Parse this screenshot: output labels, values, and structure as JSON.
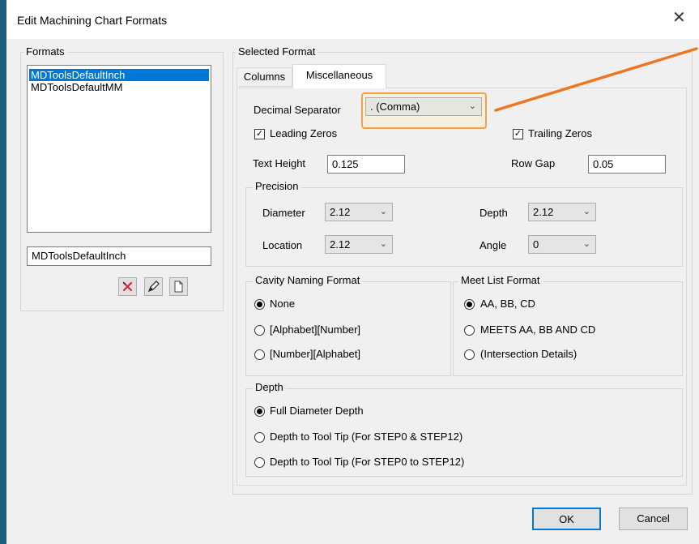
{
  "window": {
    "title": "Edit Machining Chart Formats",
    "close_glyph": "✕"
  },
  "formats": {
    "group_label": "Formats",
    "items": [
      "MDToolsDefaultInch",
      "MDToolsDefaultMM"
    ],
    "selected_index": 0,
    "name_value": "MDToolsDefaultInch",
    "icons": [
      "delete-icon",
      "edit-pencil-icon",
      "new-document-icon"
    ]
  },
  "selected_format": {
    "group_label": "Selected Format",
    "tabs": [
      "Columns",
      "Miscellaneous"
    ],
    "active_tab": "Miscellaneous"
  },
  "misc": {
    "decimal_separator_label": "Decimal Separator",
    "decimal_separator_value": ". (Comma)",
    "leading_zeros_label": "Leading Zeros",
    "leading_zeros_checked": true,
    "trailing_zeros_label": "Trailing Zeros",
    "trailing_zeros_checked": true,
    "text_height_label": "Text Height",
    "text_height_value": "0.125",
    "row_gap_label": "Row Gap",
    "row_gap_value": "0.05"
  },
  "precision": {
    "group_label": "Precision",
    "diameter_label": "Diameter",
    "diameter_value": "2.12",
    "depth_label": "Depth",
    "depth_value": "2.12",
    "location_label": "Location",
    "location_value": "2.12",
    "angle_label": "Angle",
    "angle_value": "0"
  },
  "cavity_naming": {
    "group_label": "Cavity Naming Format",
    "options": [
      "None",
      "[Alphabet][Number]",
      "[Number][Alphabet]"
    ],
    "selected_index": 0
  },
  "meet_list": {
    "group_label": "Meet List Format",
    "options": [
      "AA, BB, CD",
      "MEETS AA, BB AND CD",
      "(Intersection Details)"
    ],
    "selected_index": 0
  },
  "depth": {
    "group_label": "Depth",
    "options": [
      "Full Diameter Depth",
      "Depth to Tool Tip (For STEP0 & STEP12)",
      "Depth to Tool Tip (For STEP0 to STEP12)"
    ],
    "selected_index": 0
  },
  "buttons": {
    "ok_label": "OK",
    "cancel_label": "Cancel"
  },
  "colors": {
    "highlight": "#f2a34a",
    "arrow": "#ee7522",
    "selection": "#0078d7",
    "desktop": "#1f5f7c"
  },
  "chevron_glyph": "⌄"
}
